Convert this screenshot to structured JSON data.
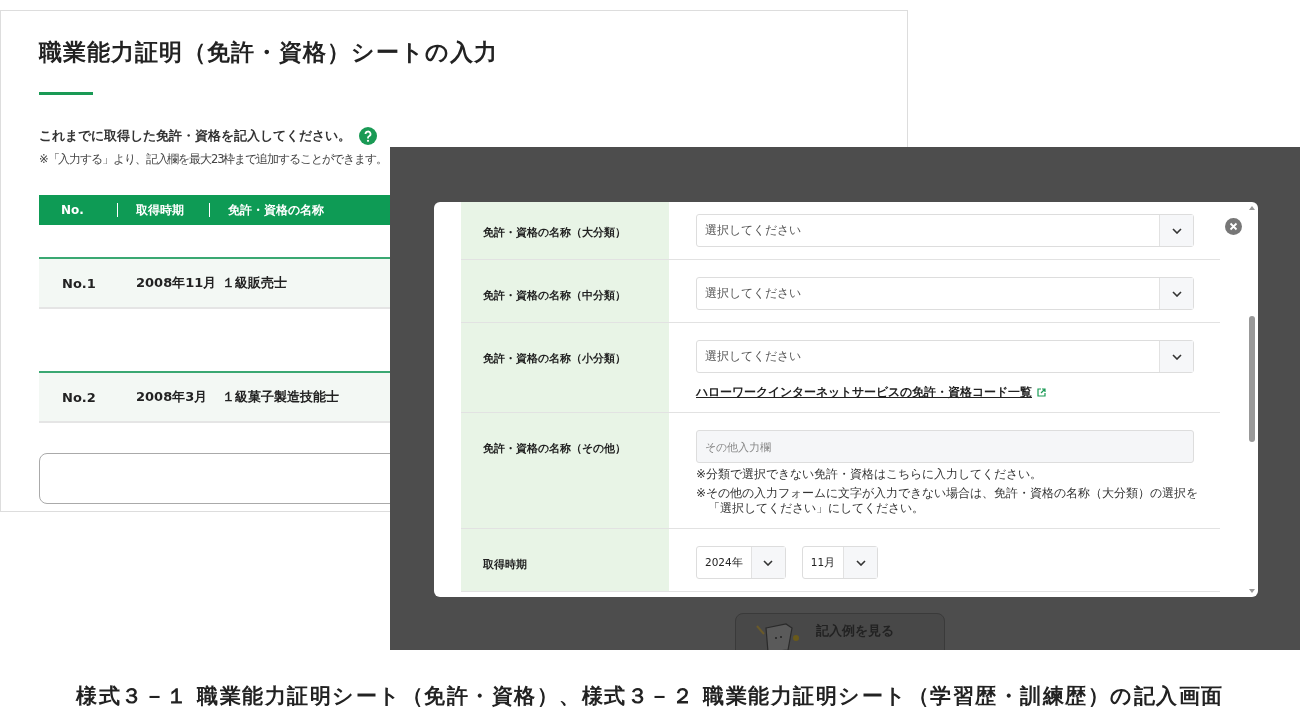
{
  "list_screen": {
    "title": "職業能力証明（免許・資格）シートの入力",
    "intro": "これまでに取得した免許・資格を記入してください。",
    "note": "※「入力する」より、記入欄を最大23枠まで追加することができます。",
    "table": {
      "columns": [
        "No.",
        "取得時期",
        "免許・資格の名称"
      ],
      "rows": [
        {
          "no": "No.1",
          "date": "2008年11月",
          "name": "１級販売士"
        },
        {
          "no": "No.2",
          "date": "2008年3月",
          "name": "１級菓子製造技能士"
        }
      ]
    }
  },
  "dialog_screen": {
    "fields": [
      {
        "kind": "select",
        "label": "免許・資格の名称（大分類）",
        "placeholder": "選択してください"
      },
      {
        "kind": "select",
        "label": "免許・資格の名称（中分類）",
        "placeholder": "選択してください"
      },
      {
        "kind": "select",
        "label": "免許・資格の名称（小分類）",
        "placeholder": "選択してください",
        "link": "ハローワークインターネットサービスの免許・資格コード一覧"
      },
      {
        "kind": "text",
        "label": "免許・資格の名称（その他）",
        "placeholder": "その他入力欄",
        "notes": [
          "※分類で選択できない免許・資格はこちらに入力してください。",
          "※その他の入力フォームに文字が入力できない場合は、免許・資格の名称（大分類）の選択を「選択してください」にしてください。"
        ]
      },
      {
        "kind": "date",
        "label": "取得時期",
        "year": "2024年",
        "month": "11月"
      }
    ],
    "example_button": "記入例を見る"
  },
  "caption": "様式３－１ 職業能力証明シート（免許・資格）、様式３－２ 職業能力証明シート（学習歴・訓練歴）の記入画面"
}
